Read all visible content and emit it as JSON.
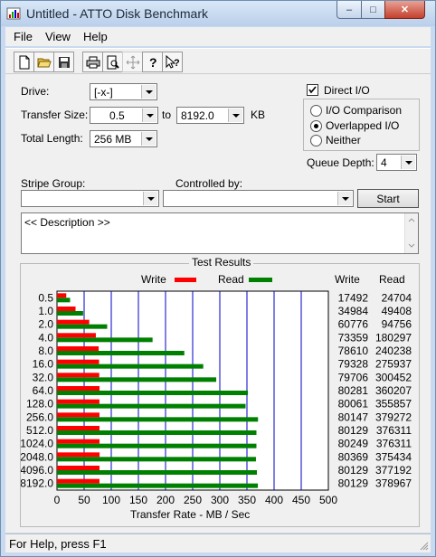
{
  "window": {
    "title": "Untitled - ATTO Disk Benchmark",
    "minimize": "–",
    "maximize": "□",
    "close": "✕"
  },
  "menu": [
    "File",
    "View",
    "Help"
  ],
  "toolbar_icons": [
    "new-icon",
    "open-icon",
    "save-icon",
    "print-icon",
    "print-preview-icon",
    "move-icon",
    "help-icon",
    "context-help-icon"
  ],
  "form": {
    "drive_label": "Drive:",
    "drive_value": "[-x-]",
    "transfer_size_label": "Transfer Size:",
    "transfer_from": "0.5",
    "to_label": "to",
    "transfer_to": "8192.0",
    "kb_label": "KB",
    "total_length_label": "Total Length:",
    "total_length_value": "256 MB",
    "direct_io_label": "Direct I/O",
    "direct_io_checked": true,
    "io_comparison_label": "I/O Comparison",
    "overlapped_io_label": "Overlapped I/O",
    "neither_label": "Neither",
    "selected_mode": "overlapped",
    "queue_depth_label": "Queue Depth:",
    "queue_depth_value": "4",
    "stripe_group_label": "Stripe Group:",
    "stripe_group_value": "",
    "controlled_by_label": "Controlled by:",
    "controlled_by_value": "",
    "start_label": "Start",
    "description_text": "<< Description >>"
  },
  "results": {
    "title": "Test Results",
    "legend_write": "Write",
    "legend_read": "Read",
    "col_write": "Write",
    "col_read": "Read",
    "write_color": "#ff0000",
    "read_color": "#008000",
    "grid_color": "#0000c8"
  },
  "chart_data": {
    "type": "bar",
    "orientation": "horizontal",
    "title": "Test Results",
    "xlabel": "Transfer Rate - MB / Sec",
    "xlim": [
      0,
      500
    ],
    "xticks": [
      "0",
      "50",
      "100",
      "150",
      "200",
      "250",
      "300",
      "350",
      "400",
      "450",
      "500"
    ],
    "categories": [
      "0.5",
      "1.0",
      "2.0",
      "4.0",
      "8.0",
      "16.0",
      "32.0",
      "64.0",
      "128.0",
      "256.0",
      "512.0",
      "1024.0",
      "2048.0",
      "4096.0",
      "8192.0"
    ],
    "series": [
      {
        "name": "Write",
        "values": [
          17.1,
          34.2,
          59.4,
          71.6,
          76.8,
          77.5,
          77.9,
          78.4,
          78.2,
          78.3,
          78.3,
          78.4,
          78.5,
          78.3,
          78.3
        ]
      },
      {
        "name": "Read",
        "values": [
          24.1,
          48.2,
          92.5,
          176.1,
          234.6,
          269.5,
          293.4,
          351.8,
          347.5,
          370.4,
          367.5,
          367.5,
          366.6,
          368.4,
          370.1
        ]
      }
    ],
    "write_text": [
      "17492",
      "34984",
      "60776",
      "73359",
      "78610",
      "79328",
      "79706",
      "80281",
      "80061",
      "80147",
      "80129",
      "80249",
      "80369",
      "80129",
      "80129"
    ],
    "read_text": [
      "24704",
      "49408",
      "94756",
      "180297",
      "240238",
      "275937",
      "300452",
      "360207",
      "355857",
      "379272",
      "376311",
      "376311",
      "375434",
      "377192",
      "378967"
    ]
  },
  "status": {
    "text": "For Help, press F1"
  }
}
